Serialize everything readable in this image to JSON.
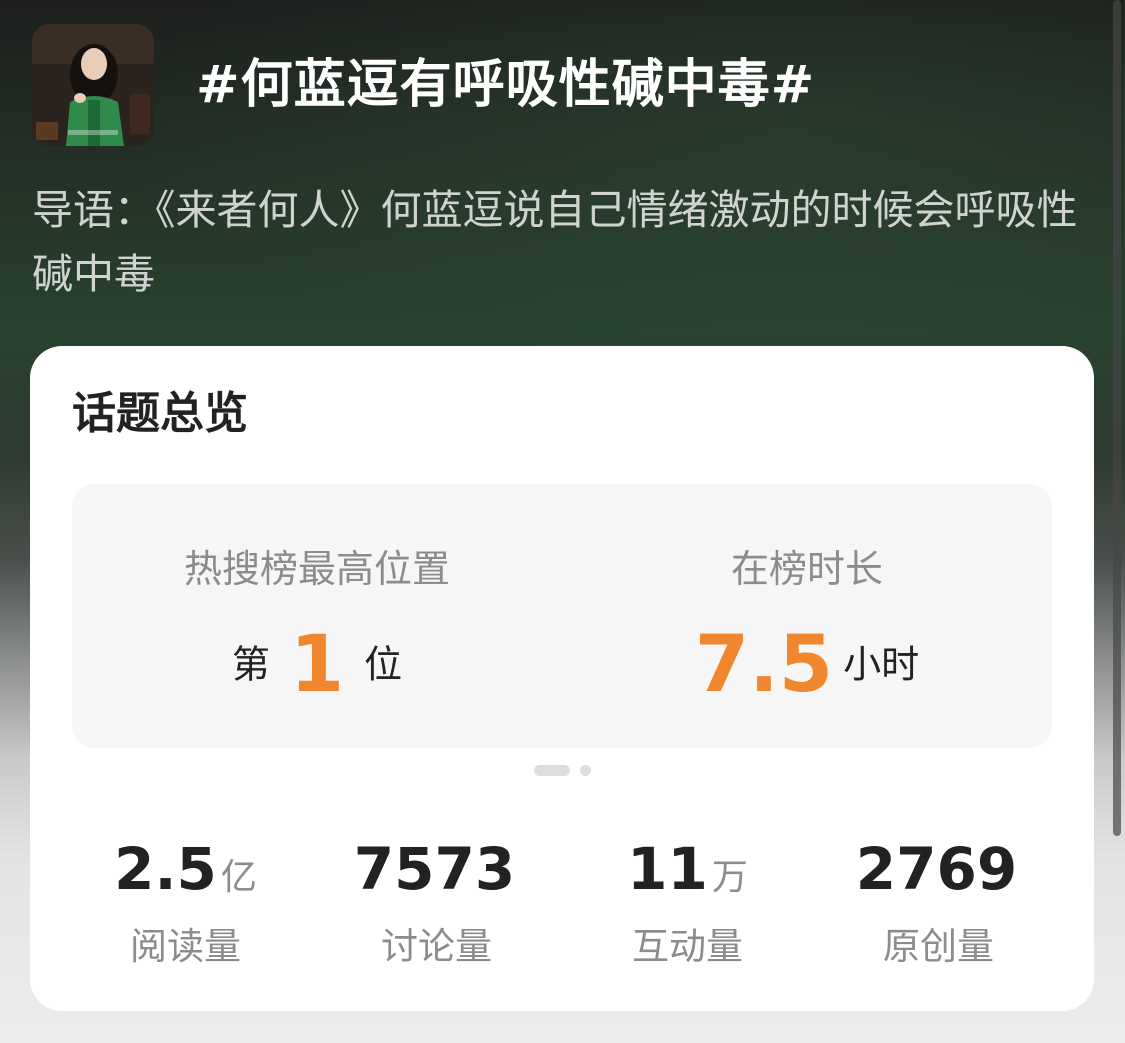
{
  "topic": {
    "title": "#何蓝逗有呼吸性碱中毒#",
    "intro": "导语：《来者何人》何蓝逗说自己情绪激动的时候会呼吸性碱中毒",
    "avatar_icon": "topic-cover-image"
  },
  "overview": {
    "title": "话题总览",
    "rank": {
      "label": "热搜榜最高位置",
      "prefix": "第",
      "value": "1",
      "suffix": "位"
    },
    "duration": {
      "label": "在榜时长",
      "value": "7.5",
      "unit": "小时"
    },
    "pager": {
      "pages": 2,
      "active": 1
    },
    "stats": [
      {
        "value": "2.5",
        "unit": "亿",
        "label": "阅读量"
      },
      {
        "value": "7573",
        "unit": "",
        "label": "讨论量"
      },
      {
        "value": "11",
        "unit": "万",
        "label": "互动量"
      },
      {
        "value": "2769",
        "unit": "",
        "label": "原创量"
      }
    ]
  },
  "colors": {
    "accent": "#f0862d",
    "text_primary": "#222222",
    "text_secondary": "#8c8c8c"
  }
}
